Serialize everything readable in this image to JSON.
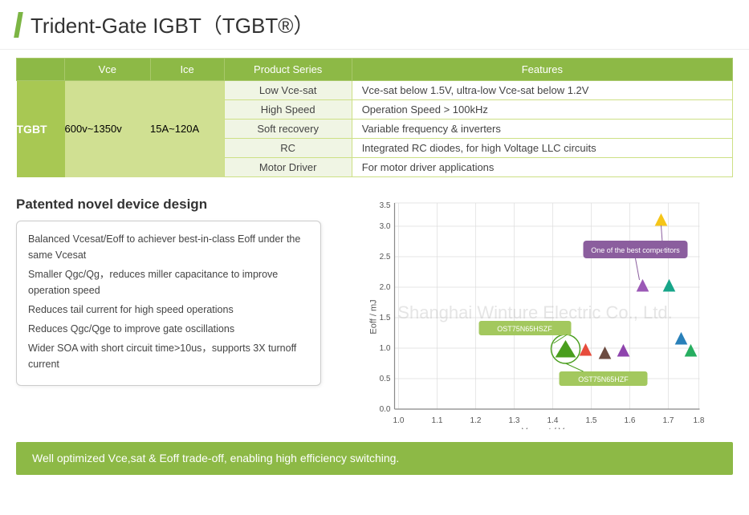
{
  "header": {
    "title": "Trident-Gate IGBT（TGBT®）"
  },
  "table": {
    "columns": [
      "",
      "Vce",
      "Ice",
      "Product Series",
      "Features"
    ],
    "rows": [
      {
        "label": "TGBT",
        "vce": "600v~1350v",
        "ice": "15A~120A",
        "products": [
          {
            "name": "Low Vce-sat",
            "feature": "Vce-sat below 1.5V, ultra-low Vce-sat below 1.2V"
          },
          {
            "name": "High Speed",
            "feature": "Operation Speed > 100kHz"
          },
          {
            "name": "Soft recovery",
            "feature": "Variable frequency & inverters"
          },
          {
            "name": "RC",
            "feature": "Integrated RC diodes, for high Voltage LLC circuits"
          },
          {
            "name": "Motor Driver",
            "feature": "For motor driver applications"
          }
        ]
      }
    ]
  },
  "design": {
    "title": "Patented novel device design",
    "points": [
      "Balanced Vcesat/Eoff to achiever best-in-class Eoff under the same Vcesat",
      "Smaller Qgc/Qg，reduces miller capacitance to improve operation speed",
      "Reduces tail current for high speed operations",
      "Reduces Qgc/Qge to improve gate oscillations",
      "Wider SOA with short circuit time>10us，supports 3X turnoff current"
    ]
  },
  "chart": {
    "x_label": "Vce,sat / V",
    "y_label": "Eoff / mJ",
    "x_min": 1.0,
    "x_max": 1.8,
    "y_min": 0.0,
    "y_max": 3.5,
    "label1": "OST75N65HSZF",
    "label2": "OST75N65HZF",
    "competitor_label": "One of the best competitors"
  },
  "watermark": "Shanghai Winture Electric Co., Ltd.",
  "banner": {
    "text": "Well optimized Vce,sat & Eoff  trade-off, enabling high efficiency switching."
  }
}
